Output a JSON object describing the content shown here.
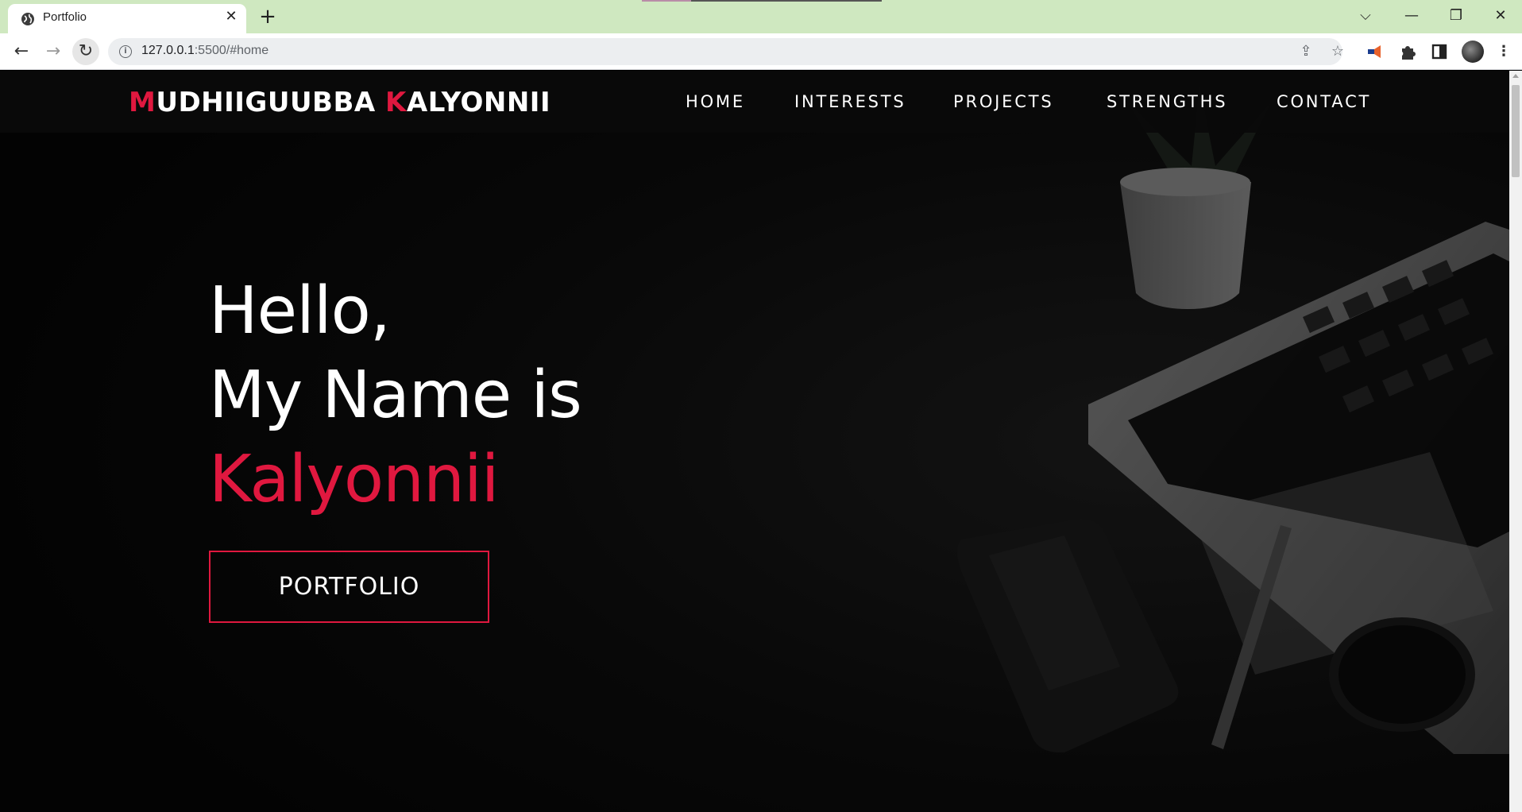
{
  "browser": {
    "tab_title": "Portfolio",
    "tab_close": "✕",
    "new_tab": "+",
    "url_host": "127.0.0.1",
    "url_rest": ":5500/#home",
    "window_controls": {
      "tab_search": "⌵",
      "minimize": "—",
      "restore": "❐",
      "close": "✕"
    },
    "nav": {
      "back": "←",
      "forward": "→",
      "reload": "↻"
    },
    "omnibox_icons": {
      "share": "⇪",
      "bookmark": "☆"
    },
    "extensions": {
      "megaphone": "📢",
      "puzzle": "✚",
      "sidepanel": "◧",
      "menu": "⋮"
    }
  },
  "site": {
    "brand": {
      "m": "M",
      "first_rest": "UDHIIGUUBBA ",
      "k": "K",
      "last_rest": "ALYONNII"
    },
    "nav_links": [
      "HOME",
      "INTERESTS",
      "PROJECTS",
      "STRENGTHS",
      "CONTACT"
    ],
    "hero": {
      "line1": "Hello,",
      "line2": "My Name is",
      "name": "Kalyonnii"
    },
    "cta_label": "PORTFOLIO"
  },
  "colors": {
    "accent": "#e0183f",
    "tabbar": "#cfe8c0",
    "page_bg": "#060606"
  }
}
